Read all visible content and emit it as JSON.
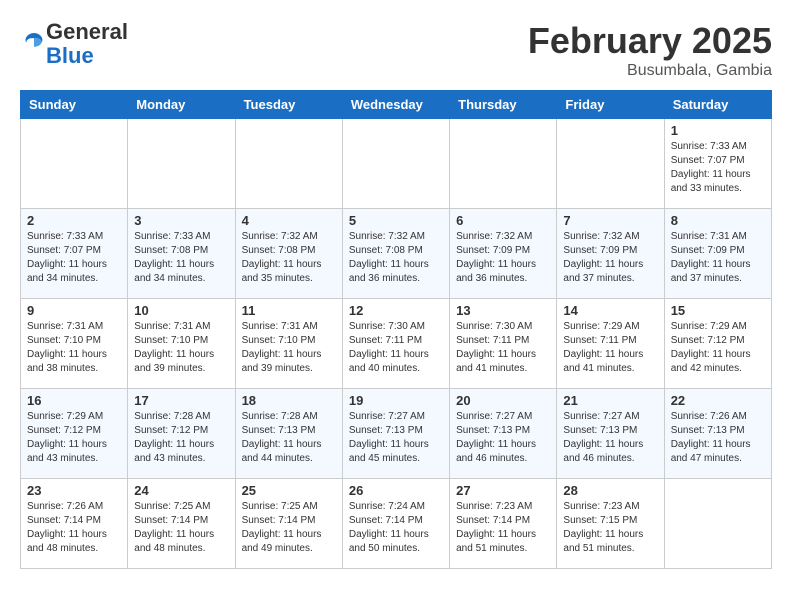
{
  "header": {
    "logo_general": "General",
    "logo_blue": "Blue",
    "month_title": "February 2025",
    "location": "Busumbala, Gambia"
  },
  "weekdays": [
    "Sunday",
    "Monday",
    "Tuesday",
    "Wednesday",
    "Thursday",
    "Friday",
    "Saturday"
  ],
  "weeks": [
    [
      {
        "day": "",
        "sunrise": "",
        "sunset": "",
        "daylight": ""
      },
      {
        "day": "",
        "sunrise": "",
        "sunset": "",
        "daylight": ""
      },
      {
        "day": "",
        "sunrise": "",
        "sunset": "",
        "daylight": ""
      },
      {
        "day": "",
        "sunrise": "",
        "sunset": "",
        "daylight": ""
      },
      {
        "day": "",
        "sunrise": "",
        "sunset": "",
        "daylight": ""
      },
      {
        "day": "",
        "sunrise": "",
        "sunset": "",
        "daylight": ""
      },
      {
        "day": "1",
        "sunrise": "Sunrise: 7:33 AM",
        "sunset": "Sunset: 7:07 PM",
        "daylight": "Daylight: 11 hours and 33 minutes."
      }
    ],
    [
      {
        "day": "2",
        "sunrise": "Sunrise: 7:33 AM",
        "sunset": "Sunset: 7:07 PM",
        "daylight": "Daylight: 11 hours and 34 minutes."
      },
      {
        "day": "3",
        "sunrise": "Sunrise: 7:33 AM",
        "sunset": "Sunset: 7:08 PM",
        "daylight": "Daylight: 11 hours and 34 minutes."
      },
      {
        "day": "4",
        "sunrise": "Sunrise: 7:32 AM",
        "sunset": "Sunset: 7:08 PM",
        "daylight": "Daylight: 11 hours and 35 minutes."
      },
      {
        "day": "5",
        "sunrise": "Sunrise: 7:32 AM",
        "sunset": "Sunset: 7:08 PM",
        "daylight": "Daylight: 11 hours and 36 minutes."
      },
      {
        "day": "6",
        "sunrise": "Sunrise: 7:32 AM",
        "sunset": "Sunset: 7:09 PM",
        "daylight": "Daylight: 11 hours and 36 minutes."
      },
      {
        "day": "7",
        "sunrise": "Sunrise: 7:32 AM",
        "sunset": "Sunset: 7:09 PM",
        "daylight": "Daylight: 11 hours and 37 minutes."
      },
      {
        "day": "8",
        "sunrise": "Sunrise: 7:31 AM",
        "sunset": "Sunset: 7:09 PM",
        "daylight": "Daylight: 11 hours and 37 minutes."
      }
    ],
    [
      {
        "day": "9",
        "sunrise": "Sunrise: 7:31 AM",
        "sunset": "Sunset: 7:10 PM",
        "daylight": "Daylight: 11 hours and 38 minutes."
      },
      {
        "day": "10",
        "sunrise": "Sunrise: 7:31 AM",
        "sunset": "Sunset: 7:10 PM",
        "daylight": "Daylight: 11 hours and 39 minutes."
      },
      {
        "day": "11",
        "sunrise": "Sunrise: 7:31 AM",
        "sunset": "Sunset: 7:10 PM",
        "daylight": "Daylight: 11 hours and 39 minutes."
      },
      {
        "day": "12",
        "sunrise": "Sunrise: 7:30 AM",
        "sunset": "Sunset: 7:11 PM",
        "daylight": "Daylight: 11 hours and 40 minutes."
      },
      {
        "day": "13",
        "sunrise": "Sunrise: 7:30 AM",
        "sunset": "Sunset: 7:11 PM",
        "daylight": "Daylight: 11 hours and 41 minutes."
      },
      {
        "day": "14",
        "sunrise": "Sunrise: 7:29 AM",
        "sunset": "Sunset: 7:11 PM",
        "daylight": "Daylight: 11 hours and 41 minutes."
      },
      {
        "day": "15",
        "sunrise": "Sunrise: 7:29 AM",
        "sunset": "Sunset: 7:12 PM",
        "daylight": "Daylight: 11 hours and 42 minutes."
      }
    ],
    [
      {
        "day": "16",
        "sunrise": "Sunrise: 7:29 AM",
        "sunset": "Sunset: 7:12 PM",
        "daylight": "Daylight: 11 hours and 43 minutes."
      },
      {
        "day": "17",
        "sunrise": "Sunrise: 7:28 AM",
        "sunset": "Sunset: 7:12 PM",
        "daylight": "Daylight: 11 hours and 43 minutes."
      },
      {
        "day": "18",
        "sunrise": "Sunrise: 7:28 AM",
        "sunset": "Sunset: 7:13 PM",
        "daylight": "Daylight: 11 hours and 44 minutes."
      },
      {
        "day": "19",
        "sunrise": "Sunrise: 7:27 AM",
        "sunset": "Sunset: 7:13 PM",
        "daylight": "Daylight: 11 hours and 45 minutes."
      },
      {
        "day": "20",
        "sunrise": "Sunrise: 7:27 AM",
        "sunset": "Sunset: 7:13 PM",
        "daylight": "Daylight: 11 hours and 46 minutes."
      },
      {
        "day": "21",
        "sunrise": "Sunrise: 7:27 AM",
        "sunset": "Sunset: 7:13 PM",
        "daylight": "Daylight: 11 hours and 46 minutes."
      },
      {
        "day": "22",
        "sunrise": "Sunrise: 7:26 AM",
        "sunset": "Sunset: 7:13 PM",
        "daylight": "Daylight: 11 hours and 47 minutes."
      }
    ],
    [
      {
        "day": "23",
        "sunrise": "Sunrise: 7:26 AM",
        "sunset": "Sunset: 7:14 PM",
        "daylight": "Daylight: 11 hours and 48 minutes."
      },
      {
        "day": "24",
        "sunrise": "Sunrise: 7:25 AM",
        "sunset": "Sunset: 7:14 PM",
        "daylight": "Daylight: 11 hours and 48 minutes."
      },
      {
        "day": "25",
        "sunrise": "Sunrise: 7:25 AM",
        "sunset": "Sunset: 7:14 PM",
        "daylight": "Daylight: 11 hours and 49 minutes."
      },
      {
        "day": "26",
        "sunrise": "Sunrise: 7:24 AM",
        "sunset": "Sunset: 7:14 PM",
        "daylight": "Daylight: 11 hours and 50 minutes."
      },
      {
        "day": "27",
        "sunrise": "Sunrise: 7:23 AM",
        "sunset": "Sunset: 7:14 PM",
        "daylight": "Daylight: 11 hours and 51 minutes."
      },
      {
        "day": "28",
        "sunrise": "Sunrise: 7:23 AM",
        "sunset": "Sunset: 7:15 PM",
        "daylight": "Daylight: 11 hours and 51 minutes."
      },
      {
        "day": "",
        "sunrise": "",
        "sunset": "",
        "daylight": ""
      }
    ]
  ]
}
